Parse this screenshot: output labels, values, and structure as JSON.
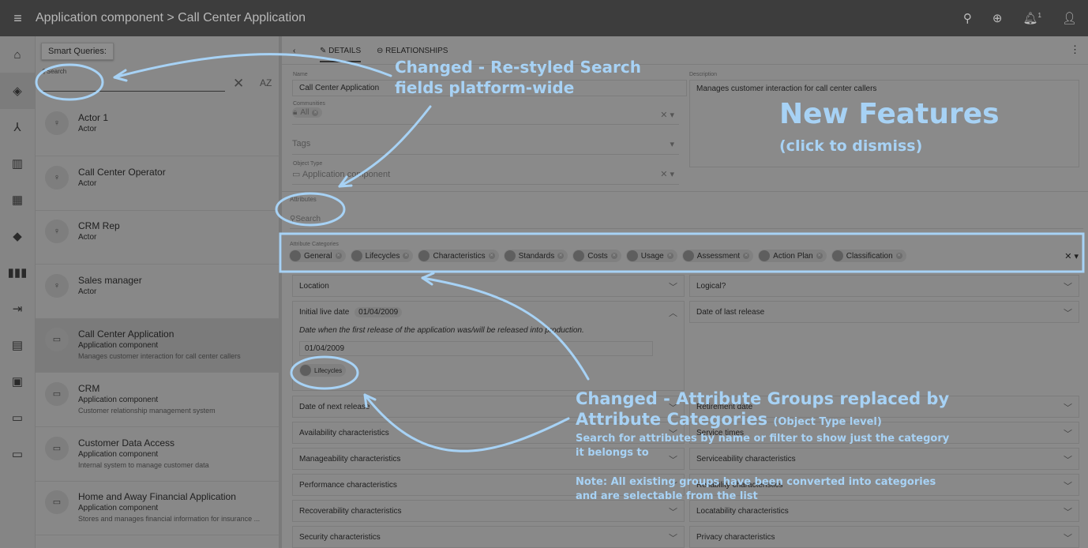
{
  "header": {
    "title": "Application component > Call Center Application",
    "notif_count": "1"
  },
  "list": {
    "smart_queries": "Smart Queries:",
    "search_label": "Search",
    "sort_label": "AZ",
    "items": [
      {
        "name": "Actor 1",
        "type": "Actor",
        "desc": ""
      },
      {
        "name": "Call Center Operator",
        "type": "Actor",
        "desc": ""
      },
      {
        "name": "CRM Rep",
        "type": "Actor",
        "desc": ""
      },
      {
        "name": "Sales manager",
        "type": "Actor",
        "desc": ""
      },
      {
        "name": "Call Center Application",
        "type": "Application component",
        "desc": "Manages customer interaction for call center callers"
      },
      {
        "name": "CRM",
        "type": "Application component",
        "desc": "Customer relationship management system"
      },
      {
        "name": "Customer Data Access",
        "type": "Application component",
        "desc": "Internal system to manage customer data"
      },
      {
        "name": "Home and Away Financial Application",
        "type": "Application component",
        "desc": "Stores and manages financial information for insurance ..."
      }
    ]
  },
  "tabs": {
    "details": "DETAILS",
    "relationships": "RELATIONSHIPS"
  },
  "form": {
    "name_label": "Name",
    "name_value": "Call Center Application",
    "desc_label": "Description",
    "desc_value": "Manages customer interaction for call center callers",
    "communities_label": "Communities",
    "community": "All",
    "tags_placeholder": "Tags",
    "object_type_label": "Object Type",
    "object_type": "Application component",
    "attributes_label": "Attributes",
    "attr_search_placeholder": "Search",
    "categories_label": "Attribute Categories",
    "categories": [
      "General",
      "Lifecycles",
      "Characteristics",
      "Standards",
      "Costs",
      "Usage",
      "Assessment",
      "Action Plan",
      "Classification"
    ]
  },
  "attributes": {
    "left": [
      "Location",
      "Initial live date",
      "Date of next release",
      "Availability characteristics",
      "Manageability characteristics",
      "Performance characteristics",
      "Recoverability characteristics",
      "Security characteristics"
    ],
    "right": [
      "Logical?",
      "Date of last release",
      "Retirement date",
      "Service times",
      "Serviceability characteristics",
      "Reliability characteristics",
      "Locatability characteristics",
      "Privacy characteristics"
    ],
    "initial_live_value": "01/04/2009",
    "initial_live_desc": "Date when the first release of the application was/will be released into production.",
    "initial_live_category": "Lifecycles"
  },
  "annotations": {
    "search": "Changed - Re-styled Search fields platform-wide",
    "new_features": "New Features",
    "dismiss": "(click to dismiss)",
    "groups_title1": "Changed - Attribute Groups replaced by",
    "groups_title2": "Attribute Categories",
    "groups_level": "(Object Type level)",
    "groups_desc": "Search for attributes by name or filter to show just the category it belongs to",
    "groups_note": "Note: All existing groups have been converted into categories and are selectable from the list"
  }
}
